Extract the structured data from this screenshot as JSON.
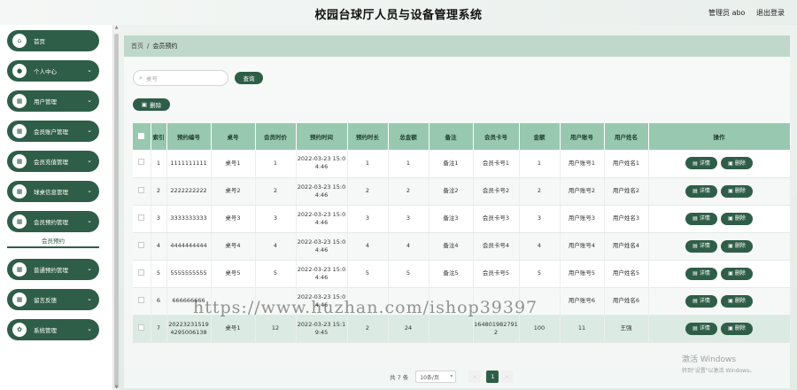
{
  "app": {
    "title": "校园台球厅人员与设备管理系统"
  },
  "header": {
    "user_label": "管理员 abo",
    "logout_label": "退出登录"
  },
  "sidebar": {
    "items": [
      {
        "label": "首页",
        "icon": "home-icon",
        "glyph": "⌂",
        "has_chevron": false
      },
      {
        "label": "个人中心",
        "icon": "user-icon",
        "glyph": "●",
        "has_chevron": true
      },
      {
        "label": "用户管理",
        "icon": "grid-icon",
        "glyph": "▦",
        "has_chevron": true
      },
      {
        "label": "会员账户管理",
        "icon": "grid-icon",
        "glyph": "▦",
        "has_chevron": true
      },
      {
        "label": "会员充值管理",
        "icon": "grid-icon",
        "glyph": "▦",
        "has_chevron": true
      },
      {
        "label": "球桌信息管理",
        "icon": "grid-icon",
        "glyph": "▦",
        "has_chevron": true
      },
      {
        "label": "会员预约管理",
        "icon": "grid-icon",
        "glyph": "▦",
        "has_chevron": true
      },
      {
        "label": "普通预约管理",
        "icon": "grid-icon",
        "glyph": "▦",
        "has_chevron": true
      },
      {
        "label": "留言反馈",
        "icon": "grid-icon",
        "glyph": "▦",
        "has_chevron": true
      },
      {
        "label": "系统管理",
        "icon": "gear-icon",
        "glyph": "✿",
        "has_chevron": true
      }
    ],
    "active_sub": "会员预约"
  },
  "breadcrumb": {
    "home": "首页",
    "sep": "/",
    "current": "会员预约"
  },
  "search": {
    "placeholder": "桌号",
    "button": "查询",
    "icon": "search-icon"
  },
  "toolbar": {
    "delete_label": "删除"
  },
  "table": {
    "headers": [
      "索引",
      "预约编号",
      "桌号",
      "会员时价",
      "预约时间",
      "预约时长",
      "总金额",
      "备注",
      "会员卡号",
      "金额",
      "用户账号",
      "用户姓名",
      "操作"
    ],
    "rows": [
      [
        "1",
        "1111111111",
        "桌号1",
        "1",
        "2022-03-23 15:04:46",
        "1",
        "1",
        "备注1",
        "会员卡号1",
        "1",
        "用户账号1",
        "用户姓名1"
      ],
      [
        "2",
        "2222222222",
        "桌号2",
        "2",
        "2022-03-23 15:04:46",
        "2",
        "2",
        "备注2",
        "会员卡号2",
        "2",
        "用户账号2",
        "用户姓名2"
      ],
      [
        "3",
        "3333333333",
        "桌号3",
        "3",
        "2022-03-23 15:04:46",
        "3",
        "3",
        "备注3",
        "会员卡号3",
        "3",
        "用户账号3",
        "用户姓名3"
      ],
      [
        "4",
        "4444444444",
        "桌号4",
        "4",
        "2022-03-23 15:04:46",
        "4",
        "4",
        "备注4",
        "会员卡号4",
        "4",
        "用户账号4",
        "用户姓名4"
      ],
      [
        "5",
        "5555555555",
        "桌号5",
        "5",
        "2022-03-23 15:04:46",
        "5",
        "5",
        "备注5",
        "会员卡号5",
        "5",
        "用户账号5",
        "用户姓名5"
      ],
      [
        "6",
        "666666666",
        "",
        "",
        "2022-03-23 15:04:46",
        "",
        "",
        "",
        "",
        "",
        "用户账号6",
        "用户姓名6"
      ],
      [
        "7",
        "202232315194295006138",
        "桌号1",
        "12",
        "2022-03-23 15:19:45",
        "2",
        "24",
        "",
        "1648019827912",
        "100",
        "11",
        "王强"
      ]
    ],
    "detail_label": "详情",
    "delete_label": "删除"
  },
  "pager": {
    "total": "共 7 条",
    "page_size": "10条/页",
    "prev": "‹",
    "current": "1",
    "next": "›"
  },
  "overlay": {
    "watermark": "https://www.huzhan.com/ishop39397",
    "activate_title": "激活 Windows",
    "activate_hint": "转到\"设置\"以激活 Windows。"
  },
  "colors": {
    "accent": "#2f5e48",
    "header_row": "#99c8b0",
    "breadcrumb": "#bfd8cb"
  }
}
